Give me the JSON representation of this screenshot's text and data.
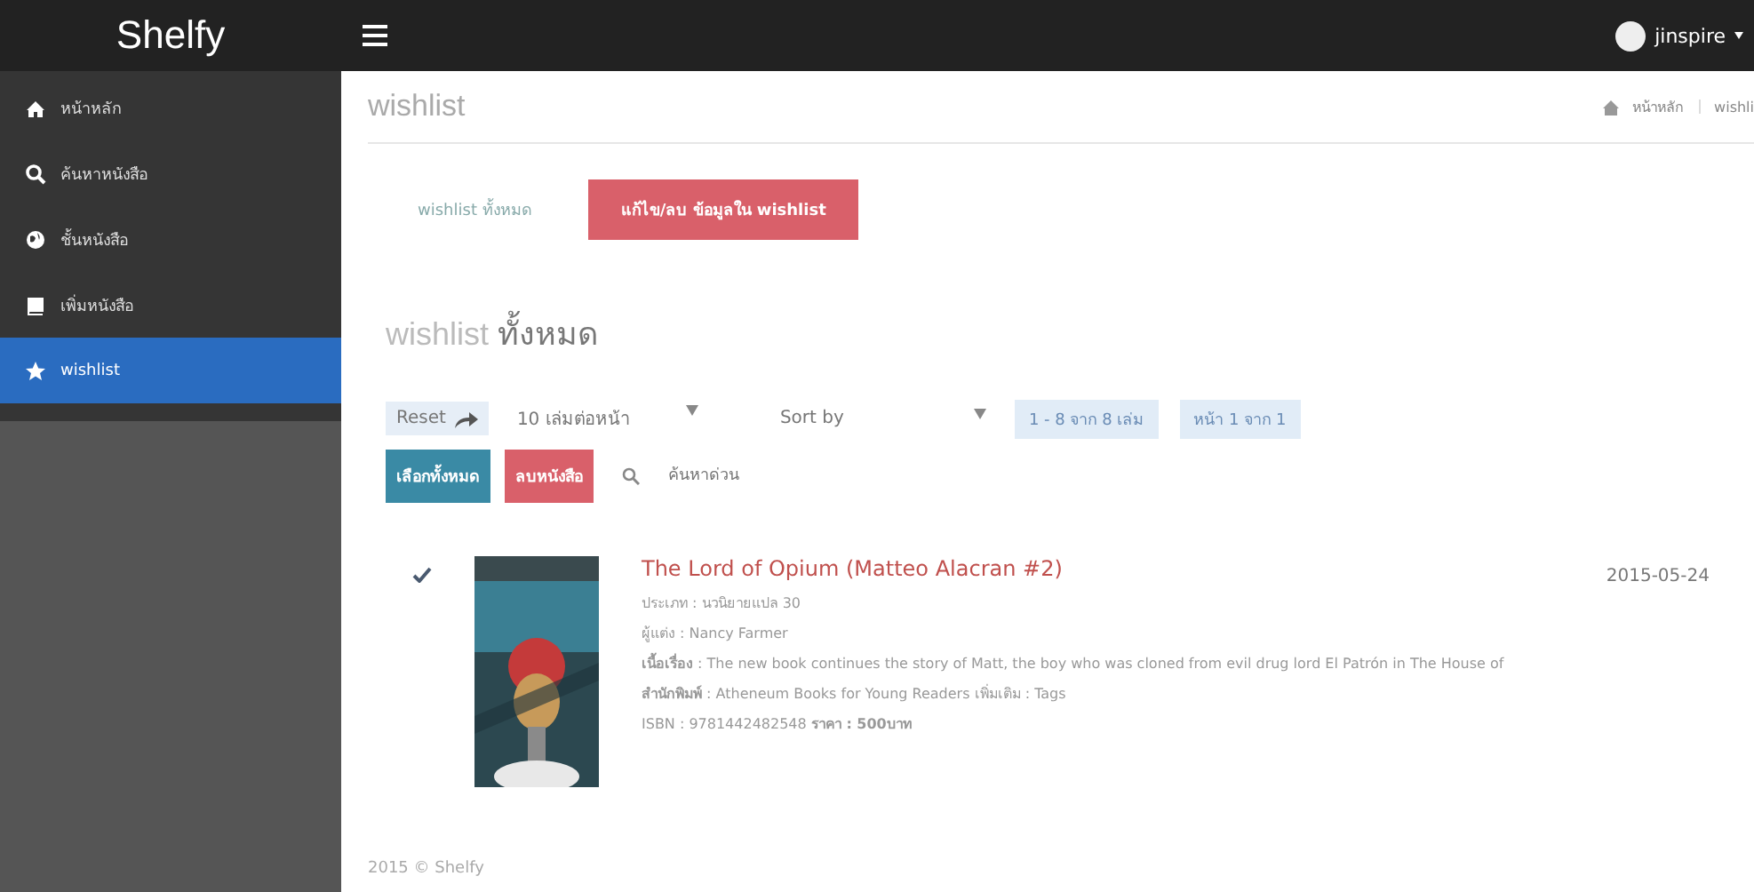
{
  "topbar": {
    "brand": "Shelfy",
    "user": "jinspire"
  },
  "sidebar": {
    "items": [
      {
        "label": "หน้าหลัก",
        "selected": false
      },
      {
        "label": "ค้นหาหนังสือ",
        "selected": false
      },
      {
        "label": "ชั้นหนังสือ",
        "selected": false
      },
      {
        "label": "เพิ่มหนังสือ",
        "selected": false
      },
      {
        "label": "wishlist",
        "selected": true
      }
    ]
  },
  "page": {
    "title": "wishlist",
    "breadcrumb": [
      "หน้าหลัก",
      "wishli"
    ]
  },
  "tabs": [
    {
      "label": "wishlist ทั้งหมด",
      "selected": false
    },
    {
      "label": "แก้ไข/ลบ ข้อมูลใน wishlist",
      "selected": true
    }
  ],
  "section_title": "wishlist **ทั้งหมด**",
  "toolbar": {
    "reset": "Reset",
    "per_page": "10 เล่มต่อหน้า",
    "sort": "Sort by",
    "range": "1 - 8 จาก 8 เล่ม",
    "page": "หน้า 1 จาก 1"
  },
  "actions": {
    "select_all": "เลือกทั้งหมด",
    "delete": "ลบหนังสือ",
    "search_placeholder": "ค้นหาด่วน"
  },
  "books": [
    {
      "checked": true,
      "title": "The Lord of Opium (Matteo Alacran #2)",
      "date": "2015-05-24",
      "lines": [
        "ประเภท : นวนิยายแปล 30",
        "ผู้แต่ง : Nancy Farmer",
        "**เนื้อเรื่อง** : The new book continues the story of Matt, the boy who was cloned from evil drug lord El Patrón in The House of",
        "**สำนักพิมพ์** : Atheneum Books for Young Readers  เพิ่มเติม : Tags",
        "ISBN : 9781442482548   **ราคา : 500บาท**"
      ]
    }
  ],
  "footer": "2015 © Shelfy"
}
